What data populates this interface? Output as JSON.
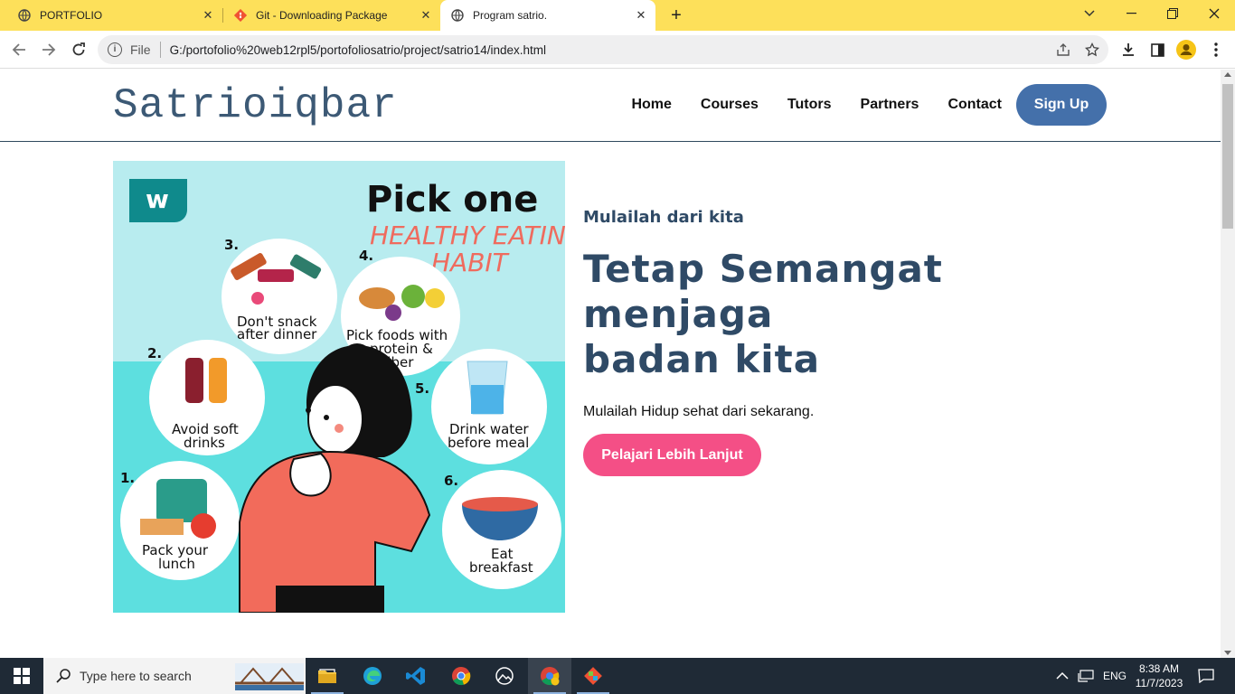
{
  "browser": {
    "tabs": [
      {
        "label": "PORTFOLIO",
        "close": "✕"
      },
      {
        "label": "Git - Downloading Package",
        "close": "✕"
      },
      {
        "label": "Program satrio.",
        "close": "✕"
      }
    ],
    "new_tab": "+",
    "window_controls": {
      "dropdown": "⌄",
      "minimize": "—",
      "restore": "❐",
      "close": "✕"
    },
    "omnibox": {
      "security": "i",
      "scheme_label": "File",
      "url": "G:/portofolio%20web12rpl5/portofoliosatrio/project/satrio14/index.html"
    }
  },
  "site": {
    "logo": "Satrioiqbar",
    "nav": [
      "Home",
      "Courses",
      "Tutors",
      "Partners",
      "Contact"
    ],
    "signup": "Sign Up",
    "hero": {
      "subtitle": "Mulailah dari kita",
      "headline_line1": "Tetap Semangat menjaga",
      "headline_line2": "badan kita",
      "description": "Mulailah Hidup sehat dari sekarang.",
      "cta": "Pelajari Lebih Lanjut"
    },
    "poster": {
      "brand": "w",
      "title": "Pick one",
      "subtitle_line1": "HEALTHY EATING",
      "subtitle_line2": "HABIT",
      "items": [
        {
          "num": "1.",
          "line1": "Pack your",
          "line2": "lunch"
        },
        {
          "num": "2.",
          "line1": "Avoid soft",
          "line2": "drinks"
        },
        {
          "num": "3.",
          "line1": "Don't snack",
          "line2": "after dinner"
        },
        {
          "num": "4.",
          "line1": "Pick foods with",
          "line2": "protein &",
          "line3": "fiber"
        },
        {
          "num": "5.",
          "line1": "Drink water",
          "line2": "before meal"
        },
        {
          "num": "6.",
          "line1": "Eat",
          "line2": "breakfast"
        }
      ]
    }
  },
  "taskbar": {
    "search_placeholder": "Type here to search",
    "language": "ENG",
    "time": "8:38 AM",
    "date": "11/7/2023"
  },
  "colors": {
    "tabstrip": "#fde05a",
    "logo": "#3c5975",
    "signup_bg": "#4470aa",
    "cta_bg": "#f44f86",
    "headline": "#2f4a66",
    "poster_sky": "#b8ecef",
    "poster_sea": "#5ddfdf"
  }
}
